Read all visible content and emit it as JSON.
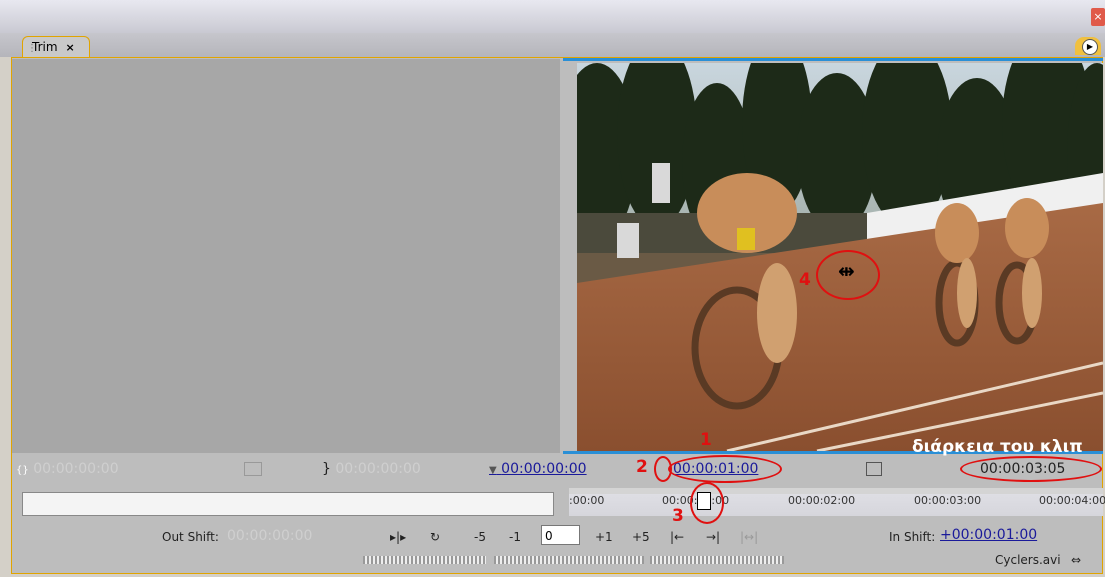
{
  "window": {
    "close_symbol": "×"
  },
  "tab": {
    "label": "Trim",
    "close": "×"
  },
  "video_caption": "διάρκεια του κλιπ",
  "left_timecodes": {
    "in_icon": "{}",
    "in": "00:00:00:00",
    "out": "00:00:00:00",
    "center": "00:00:00:00"
  },
  "right_timecodes": {
    "in": "00:00:01:00",
    "duration": "00:00:03:05"
  },
  "ruler": {
    "ticks": [
      ":00:00",
      "00:00:01:00",
      "00:00:02:00",
      "00:00:03:00",
      "00:00:04:00"
    ]
  },
  "controls": {
    "out_shift_label": "Out Shift:",
    "out_shift_value": "00:00:00:00",
    "minus5": "-5",
    "minus1": "-1",
    "field_value": "0",
    "plus1": "+1",
    "plus5": "+5",
    "in_shift_label": "In Shift:",
    "in_shift_value": "+00:00:01:00",
    "clip_name": "Cyclers.avi"
  },
  "annotations": [
    "1",
    "2",
    "3",
    "4"
  ],
  "colors": {
    "accent": "#e0a400",
    "timecode_link": "#1a1a9a",
    "annotation": "#e01010"
  }
}
